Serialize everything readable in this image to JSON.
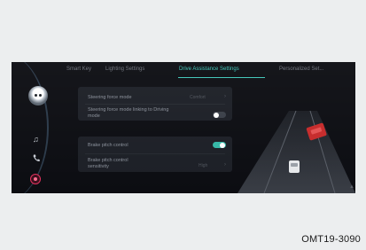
{
  "tabs": [
    {
      "label": "Smart Key"
    },
    {
      "label": "Lighting Settings"
    },
    {
      "label": "Drive Assistance Settings",
      "active": true
    },
    {
      "label": "Personalized Set..."
    }
  ],
  "sidebar": {
    "icons": [
      "music-note-icon",
      "phone-icon",
      "home-icon"
    ]
  },
  "settings": {
    "group1": {
      "steering_force_mode": {
        "label": "Steering force mode",
        "value": "Comfort"
      },
      "steering_link": {
        "label": "Steering force mode linking to Driving mode",
        "enabled": false
      }
    },
    "group2": {
      "brake_pitch": {
        "label": "Brake pitch control",
        "enabled": true
      },
      "brake_sensitivity": {
        "label": "Brake pitch control sensitivity",
        "value": "High"
      }
    }
  },
  "colors": {
    "accent": "#3fc6b8",
    "home_ring": "#e2305d",
    "lead_vehicle": "#d62f2f"
  },
  "caption": "OMT19-3090"
}
